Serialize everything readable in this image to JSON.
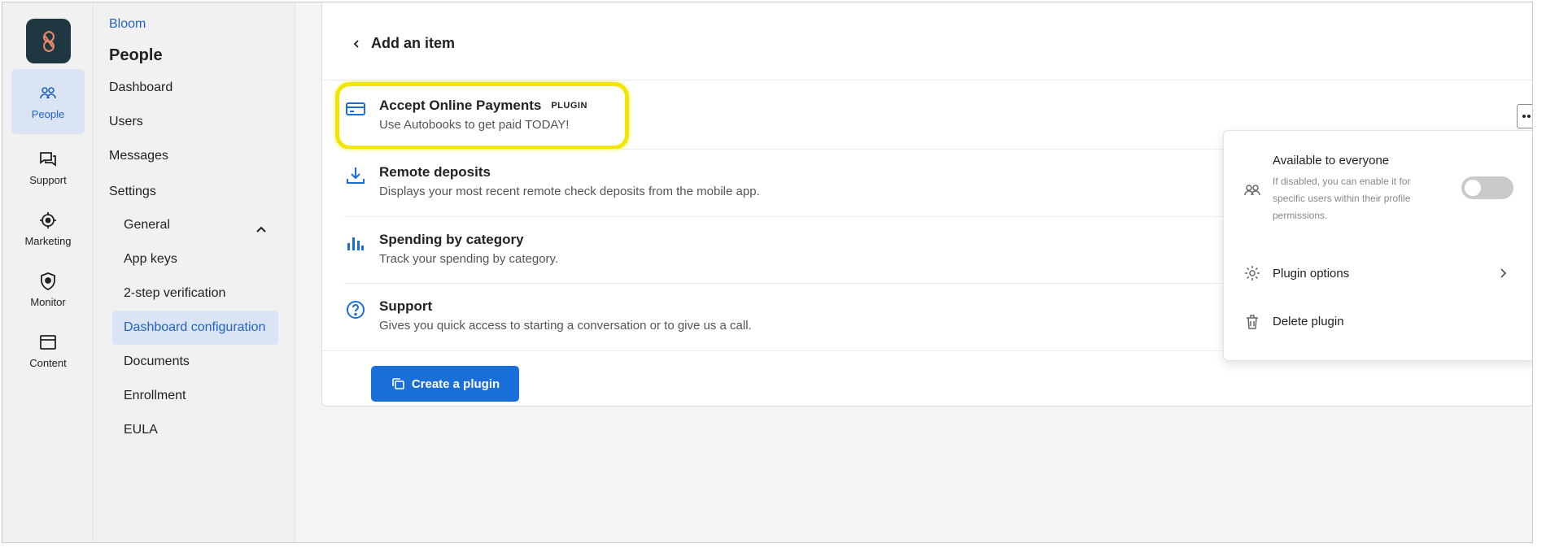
{
  "rail": {
    "items": [
      {
        "label": "People",
        "icon": "people-icon"
      },
      {
        "label": "Support",
        "icon": "chat-icon"
      },
      {
        "label": "Marketing",
        "icon": "target-icon"
      },
      {
        "label": "Monitor",
        "icon": "shield-icon"
      },
      {
        "label": "Content",
        "icon": "window-icon"
      }
    ]
  },
  "subnav": {
    "brand": "Bloom",
    "section": "People",
    "items": [
      "Dashboard",
      "Users",
      "Messages",
      "Settings"
    ],
    "settings_items": [
      "General",
      "App keys",
      "2-step verification",
      "Dashboard configuration",
      "Documents",
      "Enrollment",
      "EULA"
    ]
  },
  "main": {
    "header": "Add an item",
    "plugins": [
      {
        "title": "Accept Online Payments",
        "tag": "PLUGIN",
        "desc": "Use Autobooks to get paid TODAY!",
        "icon": "card-icon"
      },
      {
        "title": "Remote deposits",
        "desc": "Displays your most recent remote check deposits from the mobile app.",
        "icon": "download-icon"
      },
      {
        "title": "Spending by category",
        "desc": "Track your spending by category.",
        "icon": "bar-chart-icon"
      },
      {
        "title": "Support",
        "desc": "Gives you quick access to starting a conversation or to give us a call.",
        "icon": "help-icon"
      }
    ],
    "create_button": "Create a plugin"
  },
  "menu": {
    "availability_title": "Available to everyone",
    "availability_note": "If disabled, you can enable it for specific users within their profile permissions.",
    "toggle_on": false,
    "options_label": "Plugin options",
    "delete_label": "Delete plugin"
  },
  "colors": {
    "accent": "#1a6ed8",
    "highlight": "#f2e600",
    "logo_bg": "#1f3740"
  }
}
